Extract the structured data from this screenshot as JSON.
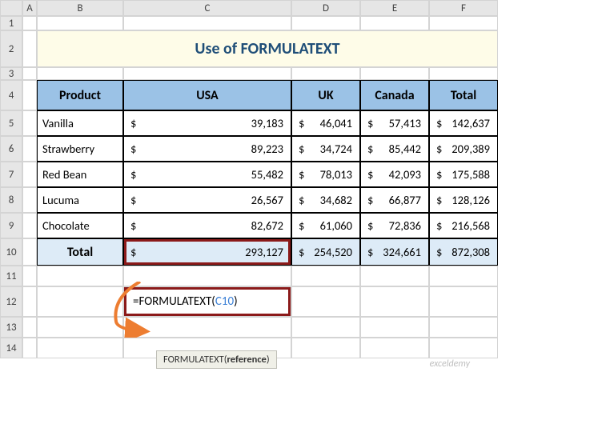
{
  "columns": [
    "",
    "A",
    "B",
    "C",
    "D",
    "E",
    "F"
  ],
  "rows": [
    "1",
    "2",
    "3",
    "4",
    "5",
    "6",
    "7",
    "8",
    "9",
    "10",
    "11",
    "12",
    "13",
    "14"
  ],
  "title": "Use of FORMULATEXT",
  "headers": {
    "product": "Product",
    "usa": "USA",
    "uk": "UK",
    "canada": "Canada",
    "total": "Total"
  },
  "products": [
    "Vanilla",
    "Strawberry",
    "Red Bean",
    "Lucuma",
    "Chocolate"
  ],
  "data": {
    "usa": [
      "39,183",
      "89,223",
      "55,482",
      "26,567",
      "82,672"
    ],
    "uk": [
      "46,041",
      "34,724",
      "78,013",
      "34,682",
      "61,060"
    ],
    "canada": [
      "57,413",
      "85,442",
      "42,093",
      "66,877",
      "72,836"
    ],
    "total": [
      "142,637",
      "209,389",
      "175,588",
      "128,126",
      "216,568"
    ]
  },
  "totals_row": {
    "label": "Total",
    "usa": "293,127",
    "uk": "254,520",
    "canada": "324,661",
    "total": "872,308"
  },
  "currency": "$",
  "formula": {
    "prefix": "=FORMULATEXT(",
    "ref": "C10",
    "suffix": ")"
  },
  "tooltip": {
    "fn": "FORMULATEXT(",
    "arg": "reference",
    "suffix": ")"
  },
  "watermark": "exceldemy"
}
